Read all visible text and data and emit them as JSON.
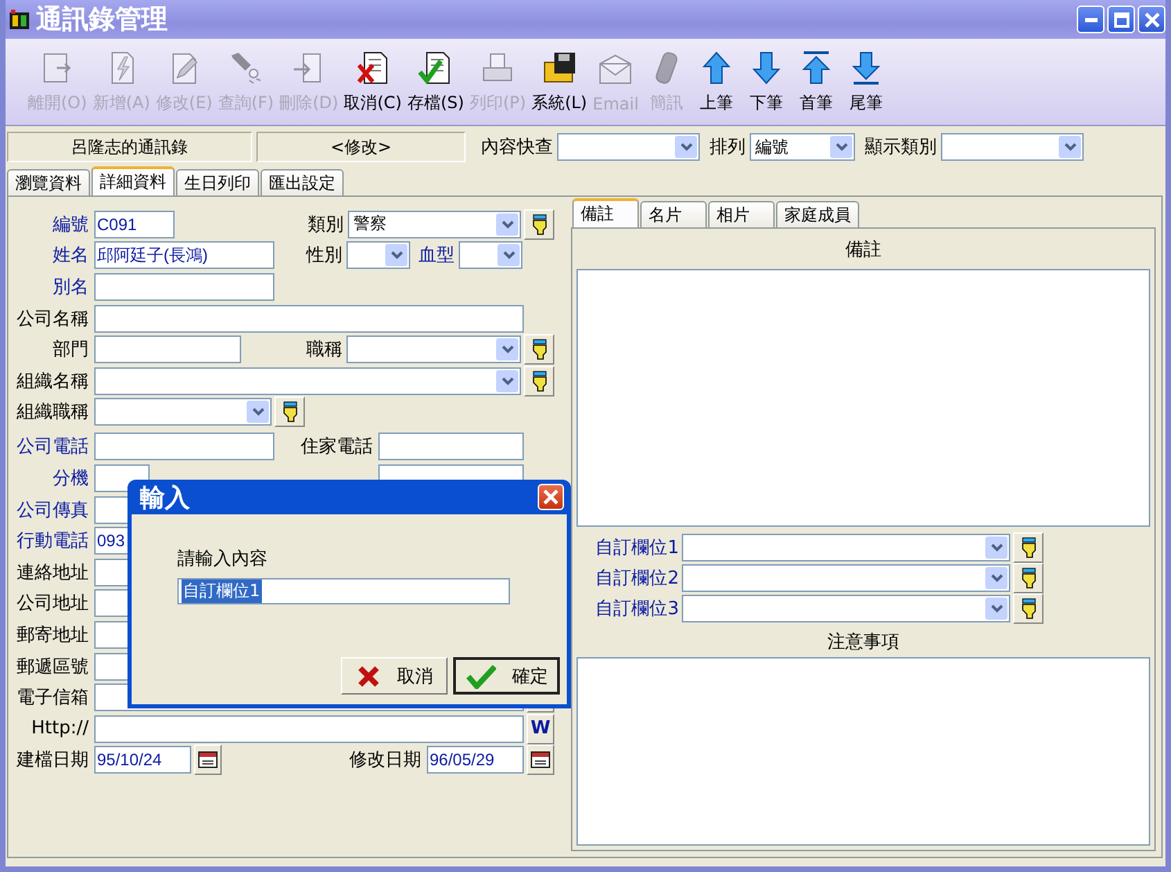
{
  "window": {
    "title": "通訊錄管理"
  },
  "toolbar": [
    {
      "label": "離開(O)",
      "kind": "exit",
      "disabled": true
    },
    {
      "label": "新增(A)",
      "kind": "add",
      "disabled": true
    },
    {
      "label": "修改(E)",
      "kind": "edit",
      "disabled": true
    },
    {
      "label": "查詢(F)",
      "kind": "search",
      "disabled": true
    },
    {
      "label": "刪除(D)",
      "kind": "delete",
      "disabled": true
    },
    {
      "label": "取消(C)",
      "kind": "cancel",
      "disabled": false
    },
    {
      "label": "存檔(S)",
      "kind": "save",
      "disabled": false
    },
    {
      "label": "列印(P)",
      "kind": "print",
      "disabled": true
    },
    {
      "label": "系統(L)",
      "kind": "system",
      "disabled": false
    },
    {
      "label": "Email",
      "kind": "email",
      "disabled": true
    },
    {
      "label": "簡訊",
      "kind": "sms",
      "disabled": true
    },
    {
      "label": "上筆",
      "kind": "prev",
      "disabled": false
    },
    {
      "label": "下筆",
      "kind": "next",
      "disabled": false
    },
    {
      "label": "首筆",
      "kind": "first",
      "disabled": false
    },
    {
      "label": "尾筆",
      "kind": "last",
      "disabled": false
    }
  ],
  "info_bar": {
    "owner": "呂隆志的通訊錄",
    "mode": "<修改>",
    "quick_search": {
      "label": "內容快查"
    },
    "sort": {
      "label": "排列",
      "value": "編號"
    },
    "category_filter": {
      "label": "顯示類別"
    }
  },
  "tabs": [
    {
      "label": "瀏覽資料",
      "selected": false
    },
    {
      "label": "詳細資料",
      "selected": true
    },
    {
      "label": "生日列印",
      "selected": false
    },
    {
      "label": "匯出設定",
      "selected": false
    }
  ],
  "form": {
    "rows": [
      {
        "cells": [
          {
            "kind": "label",
            "text": "編號",
            "highlighted": true
          },
          {
            "kind": "input",
            "value": "C091"
          },
          {
            "kind": "label",
            "text": "類別",
            "highlighted": false
          },
          {
            "kind": "select",
            "value": "警察"
          },
          {
            "kind": "pick"
          }
        ]
      },
      {
        "cells": [
          {
            "kind": "label",
            "text": "姓名",
            "highlighted": true
          },
          {
            "kind": "input",
            "value": "邱阿廷子(長鴻)"
          },
          {
            "kind": "label",
            "text": "性別",
            "highlighted": false
          },
          {
            "kind": "select"
          },
          {
            "kind": "label",
            "text": "血型",
            "highlighted": true
          },
          {
            "kind": "select"
          }
        ]
      },
      {
        "cells": [
          {
            "kind": "label",
            "text": "別名",
            "highlighted": true
          },
          {
            "kind": "input"
          }
        ]
      },
      {
        "cells": [
          {
            "kind": "label",
            "text": "公司名稱",
            "highlighted": false
          },
          {
            "kind": "input"
          }
        ]
      },
      {
        "cells": [
          {
            "kind": "label",
            "text": "部門",
            "highlighted": false
          },
          {
            "kind": "input"
          },
          {
            "kind": "label",
            "text": "職稱",
            "highlighted": false
          },
          {
            "kind": "select"
          },
          {
            "kind": "pick"
          }
        ]
      },
      {
        "cells": [
          {
            "kind": "label",
            "text": "組織名稱",
            "highlighted": false
          },
          {
            "kind": "select"
          },
          {
            "kind": "pick"
          }
        ]
      },
      {
        "cells": [
          {
            "kind": "label",
            "text": "組織職稱",
            "highlighted": false
          },
          {
            "kind": "select"
          },
          {
            "kind": "pick"
          }
        ]
      },
      {
        "cells": [
          {
            "kind": "label",
            "text": "公司電話",
            "highlighted": true
          },
          {
            "kind": "input"
          },
          {
            "kind": "label",
            "text": "住家電話",
            "highlighted": false
          },
          {
            "kind": "input"
          }
        ]
      },
      {
        "cells": [
          {
            "kind": "label",
            "text": "分機",
            "highlighted": true
          },
          {
            "kind": "input"
          },
          {
            "kind": "input"
          }
        ]
      },
      {
        "cells": [
          {
            "kind": "label",
            "text": "公司傳真",
            "highlighted": true
          },
          {
            "kind": "input"
          }
        ]
      },
      {
        "cells": [
          {
            "kind": "label",
            "text": "行動電話",
            "highlighted": true
          },
          {
            "kind": "input",
            "value": "093"
          }
        ]
      },
      {
        "cells": [
          {
            "kind": "label",
            "text": "連絡地址",
            "highlighted": false
          },
          {
            "kind": "input"
          }
        ]
      },
      {
        "cells": [
          {
            "kind": "label",
            "text": "公司地址",
            "highlighted": false
          },
          {
            "kind": "input"
          }
        ]
      },
      {
        "cells": [
          {
            "kind": "label",
            "text": "郵寄地址",
            "highlighted": false
          },
          {
            "kind": "input"
          }
        ]
      },
      {
        "cells": [
          {
            "kind": "label",
            "text": "郵遞區號",
            "highlighted": false
          },
          {
            "kind": "input"
          }
        ]
      },
      {
        "cells": [
          {
            "kind": "label",
            "text": "電子信箱",
            "highlighted": false
          },
          {
            "kind": "input"
          },
          {
            "kind": "button"
          }
        ]
      },
      {
        "cells": [
          {
            "kind": "label",
            "text": "Http://",
            "highlighted": false
          },
          {
            "kind": "input"
          },
          {
            "kind": "web",
            "text": "W"
          }
        ]
      },
      {
        "cells": [
          {
            "kind": "label",
            "text": "建檔日期",
            "highlighted": false
          },
          {
            "kind": "input",
            "value": "95/10/24"
          },
          {
            "kind": "calendar"
          },
          {
            "kind": "label",
            "text": "修改日期",
            "highlighted": false
          },
          {
            "kind": "input",
            "value": "96/05/29"
          },
          {
            "kind": "calendar"
          }
        ]
      }
    ]
  },
  "side_panel": {
    "tabs": [
      {
        "label": "備註",
        "selected": true
      },
      {
        "label": "名片",
        "selected": false
      },
      {
        "label": "相片",
        "selected": false
      },
      {
        "label": "家庭成員",
        "selected": false
      }
    ],
    "notes_header": "備註",
    "custom_fields": [
      {
        "label": "自訂欄位1"
      },
      {
        "label": "自訂欄位2"
      },
      {
        "label": "自訂欄位3"
      }
    ],
    "remarks_header": "注意事項"
  },
  "dialog": {
    "title": "輸入",
    "prompt": "請輸入內容",
    "value": "自訂欄位1",
    "value_selected": true,
    "buttons": [
      {
        "label": "取消",
        "kind": "cancel",
        "default": false
      },
      {
        "label": "確定",
        "kind": "ok",
        "default": true
      }
    ]
  }
}
